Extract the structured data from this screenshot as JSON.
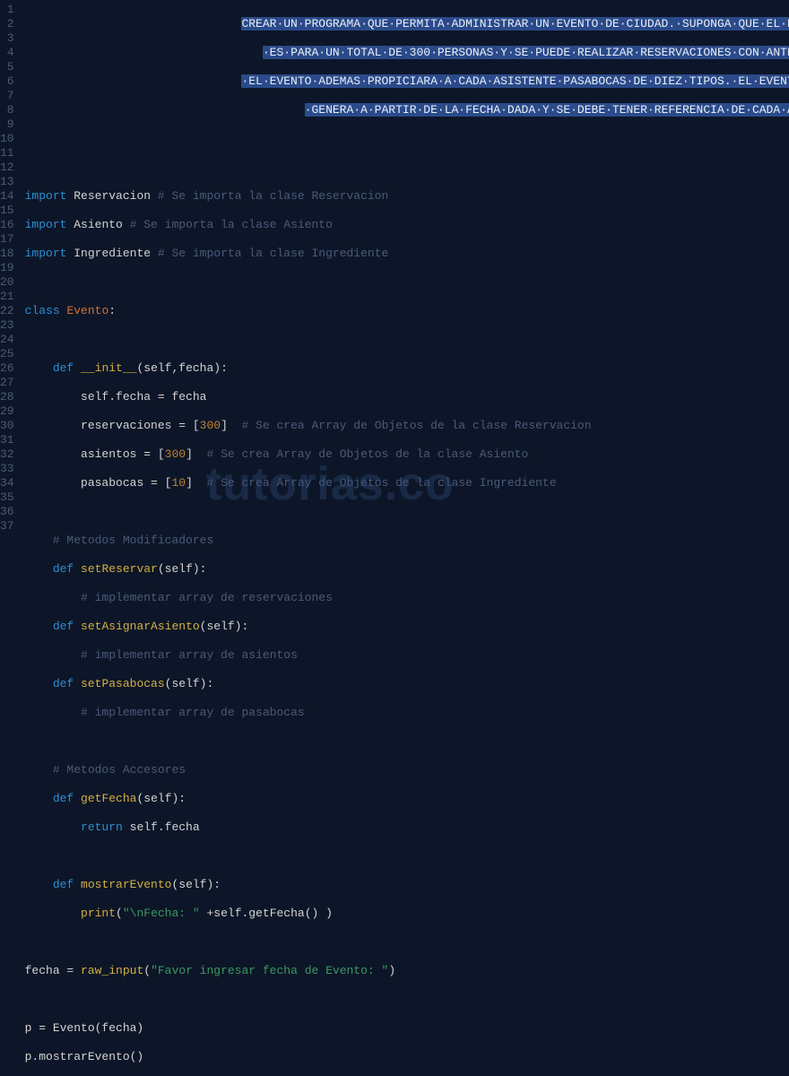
{
  "watermark": "tutorias.co",
  "header_lines": [
    "CREAR·UN·PROGRAMA·QUE·PERMITA·ADMINISTRAR·UN·EVENTO·DE·CIUDAD.·SUPONGA·QUE·EL·EVENTO",
    "·ES·PARA·UN·TOTAL·DE·300·PERSONAS·Y·SE·PUEDE·REALIZAR·RESERVACIONES·CON·ANTELACION.",
    "·EL·EVENTO·ADEMAS·PROPICIARA·A·CADA·ASISTENTE·PASABOCAS·DE·DIEZ·TIPOS.·EL·EVENTO·SE",
    "·GENERA·A·PARTIR·DE·LA·FECHA·DADA·Y·SE·DEBE·TENER·REFERENCIA·DE·CADA·ASIENTO"
  ],
  "lines": {
    "l7": {
      "import": "import",
      "mod": "Reservacion",
      "cmt": "# Se importa la clase Reservacion"
    },
    "l8": {
      "import": "import",
      "mod": "Asiento",
      "cmt": "# Se importa la clase Asiento"
    },
    "l9": {
      "import": "import",
      "mod": "Ingrediente",
      "cmt": "# Se importa la clase Ingrediente"
    },
    "l11": {
      "class": "class",
      "name": "Evento",
      "colon": ":"
    },
    "l13": {
      "def": "def",
      "fn": "__init__",
      "args": "(self,fecha):"
    },
    "l14": {
      "txt": "self.fecha = fecha"
    },
    "l15a": "reservaciones = [",
    "l15n": "300",
    "l15b": "]  ",
    "l15c": "# Se crea Array de Objetos de la clase Reservacion",
    "l16a": "asientos = [",
    "l16n": "300",
    "l16b": "]  ",
    "l16c": "# Se crea Array de Objetos de la clase Asiento",
    "l17a": "pasabocas = [",
    "l17n": "10",
    "l17b": "]  ",
    "l17c": "# Se crea Array de Objetos de la clase Ingrediente",
    "l19": "# Metodos Modificadores",
    "l20": {
      "def": "def",
      "fn": "setReservar",
      "args": "(self):"
    },
    "l21": "# implementar array de reservaciones",
    "l22": {
      "def": "def",
      "fn": "setAsignarAsiento",
      "args": "(self):"
    },
    "l23": "# implementar array de asientos",
    "l24": {
      "def": "def",
      "fn": "setPasabocas",
      "args": "(self):"
    },
    "l25": "# implementar array de pasabocas",
    "l27": "# Metodos Accesores",
    "l28": {
      "def": "def",
      "fn": "getFecha",
      "args": "(self):"
    },
    "l29": {
      "ret": "return",
      "expr": " self.fecha"
    },
    "l31": {
      "def": "def",
      "fn": "mostrarEvento",
      "args": "(self):"
    },
    "l32a": "print",
    "l32b": "(",
    "l32s": "\"\\nFecha: \"",
    "l32c": " +self.getFecha() )",
    "l34a": "fecha = ",
    "l34f": "raw_input",
    "l34b": "(",
    "l34s": "\"Favor ingresar fecha de Evento: \"",
    "l34c": ")",
    "l36": "p = Evento(fecha)",
    "l37": "p.mostrarEvento()"
  },
  "line_count": 37
}
